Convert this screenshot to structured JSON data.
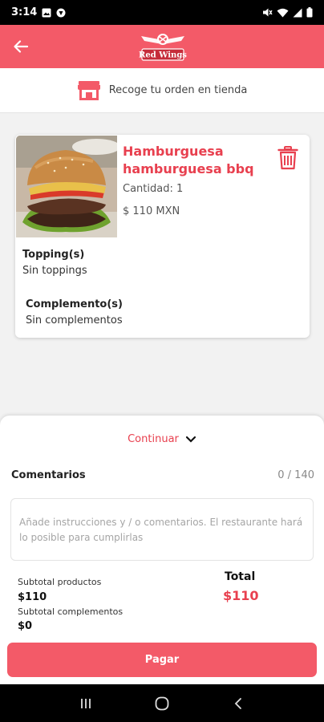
{
  "status_bar": {
    "time": "3:14",
    "icons": [
      "gallery-icon",
      "app-notification-icon",
      "mute-icon",
      "wifi-icon",
      "signal-icon",
      "battery-icon"
    ]
  },
  "app_bar": {
    "logo_text": "Red Wings",
    "back_icon": "arrow-left-icon"
  },
  "pickup": {
    "label": "Recoge tu orden en tienda",
    "icon": "store-icon"
  },
  "cart_item": {
    "name": "Hamburguesa hamburguesa bbq",
    "quantity": "Cantidad: 1",
    "price": "$ 110 MXN",
    "toppings_title": "Topping(s)",
    "toppings_value": "Sin toppings",
    "complements_title": "Complemento(s)",
    "complements_value": "Sin complementos"
  },
  "checkout": {
    "continue_label": "Continuar",
    "comments_label": "Comentarios",
    "comments_count": "0 / 140",
    "comments_placeholder": "Añade instrucciones y / o comentarios. El restaurante hará lo posible para cumplirlas",
    "subtotal_products_label": "Subtotal productos",
    "subtotal_products_value": "$110",
    "subtotal_complements_label": "Subtotal complementos",
    "subtotal_complements_value": "$0",
    "total_label": "Total",
    "total_value": "$110",
    "pay_label": "Pagar"
  },
  "colors": {
    "brand": "#f35a68",
    "accent_text": "#e8404f"
  }
}
